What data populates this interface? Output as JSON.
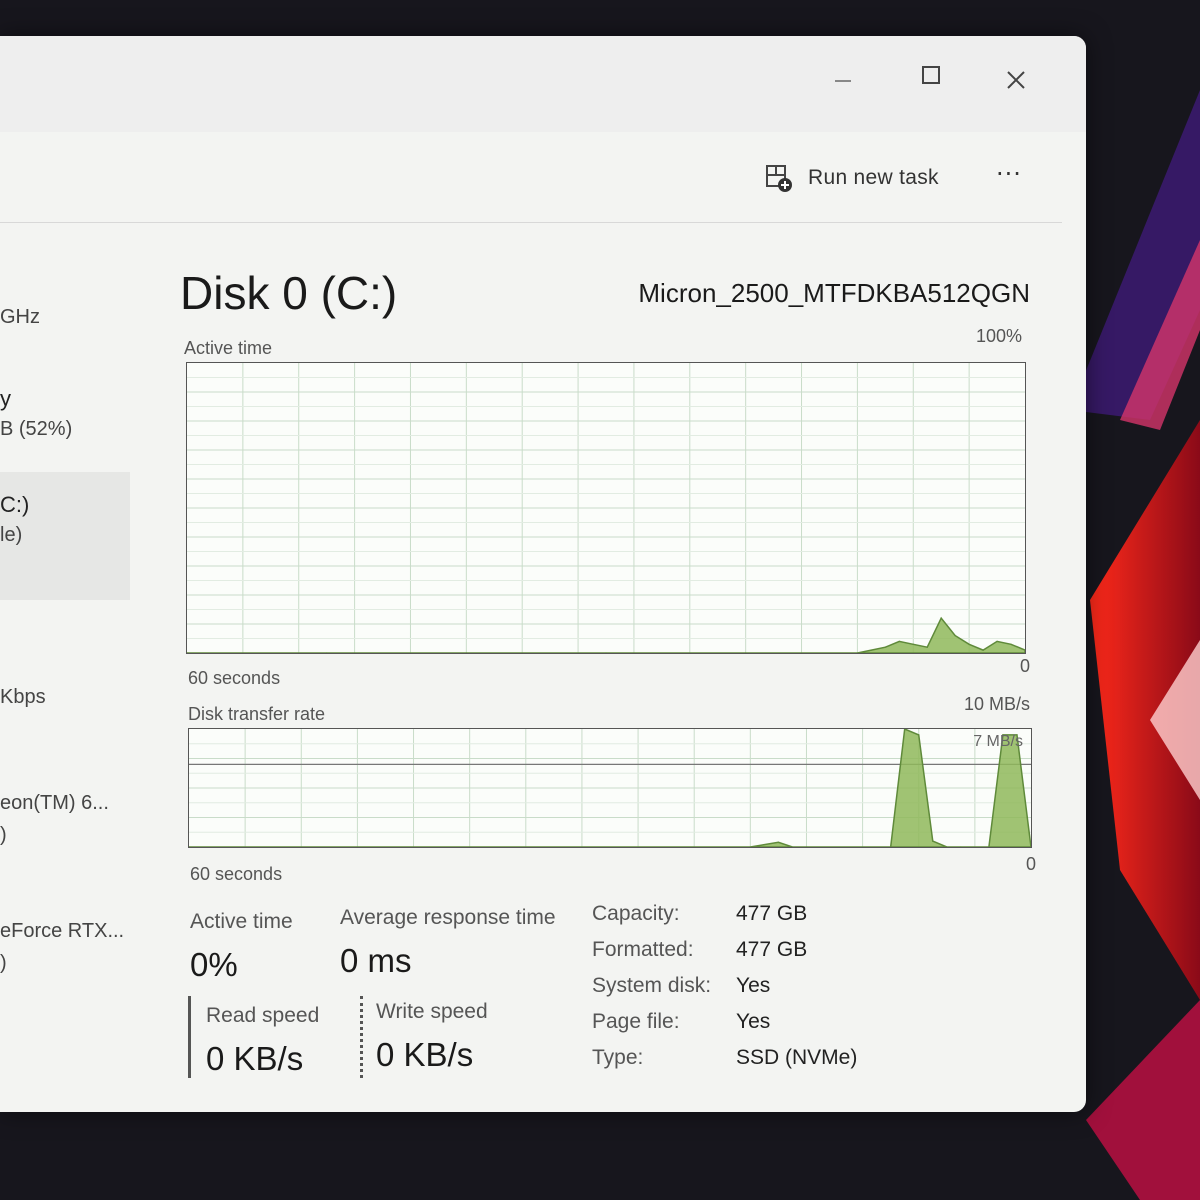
{
  "window": {
    "controls": [
      "minimize-icon",
      "maximize-icon",
      "close-icon"
    ]
  },
  "toolbar": {
    "run_new_task_label": "Run new task",
    "more_label": "···"
  },
  "sidebar": {
    "items": [
      {
        "line1": "GHz",
        "line2": ""
      },
      {
        "line1": "y",
        "line2": "B (52%)"
      },
      {
        "line1": "C:)",
        "line2": "le)"
      },
      {
        "line1": "Kbps",
        "line2": ""
      },
      {
        "line1": "eon(TM) 6...",
        "line2": ")"
      },
      {
        "line1": "eForce RTX...",
        "line2": ")"
      }
    ],
    "selected_index": 2
  },
  "disk": {
    "title": "Disk 0 (C:)",
    "model": "Micron_2500_MTFDKBA512QGN"
  },
  "chart_data": [
    {
      "type": "area",
      "label": "Active time",
      "y_max_label": "100%",
      "y_min_label": "0",
      "x_label": "60 seconds",
      "ylim": [
        0,
        100
      ],
      "x": [
        60,
        50,
        40,
        30,
        20,
        12,
        11,
        10,
        9,
        8,
        7,
        6,
        5,
        4,
        3,
        2,
        1,
        0
      ],
      "values": [
        0,
        0,
        0,
        0,
        0,
        0,
        1,
        2,
        4,
        3,
        2,
        12,
        6,
        3,
        1,
        4,
        3,
        1
      ],
      "color": "#8fb85a",
      "grid": true
    },
    {
      "type": "area",
      "label": "Disk transfer rate",
      "y_max_label": "10 MB/s",
      "y_min_label": "0",
      "x_label": "60 seconds",
      "reference_line_label": "7 MB/s",
      "reference_line_value": 7,
      "ylim": [
        0,
        10
      ],
      "x": [
        60,
        20,
        18,
        17,
        16,
        10,
        9,
        8,
        7,
        6,
        5,
        3,
        2,
        1,
        0
      ],
      "values": [
        0,
        0,
        0.4,
        0,
        0,
        0,
        10,
        9.5,
        0.5,
        0,
        0,
        0,
        9.5,
        9.5,
        0
      ],
      "color": "#8fb85a",
      "grid": true
    }
  ],
  "stats": {
    "active_time_label": "Active time",
    "active_time_value": "0%",
    "avg_response_label": "Average response time",
    "avg_response_value": "0 ms",
    "read_speed_label": "Read speed",
    "read_speed_value": "0 KB/s",
    "write_speed_label": "Write speed",
    "write_speed_value": "0 KB/s"
  },
  "info": [
    {
      "key": "Capacity:",
      "value": "477 GB"
    },
    {
      "key": "Formatted:",
      "value": "477 GB"
    },
    {
      "key": "System disk:",
      "value": "Yes"
    },
    {
      "key": "Page file:",
      "value": "Yes"
    },
    {
      "key": "Type:",
      "value": "SSD (NVMe)"
    }
  ]
}
